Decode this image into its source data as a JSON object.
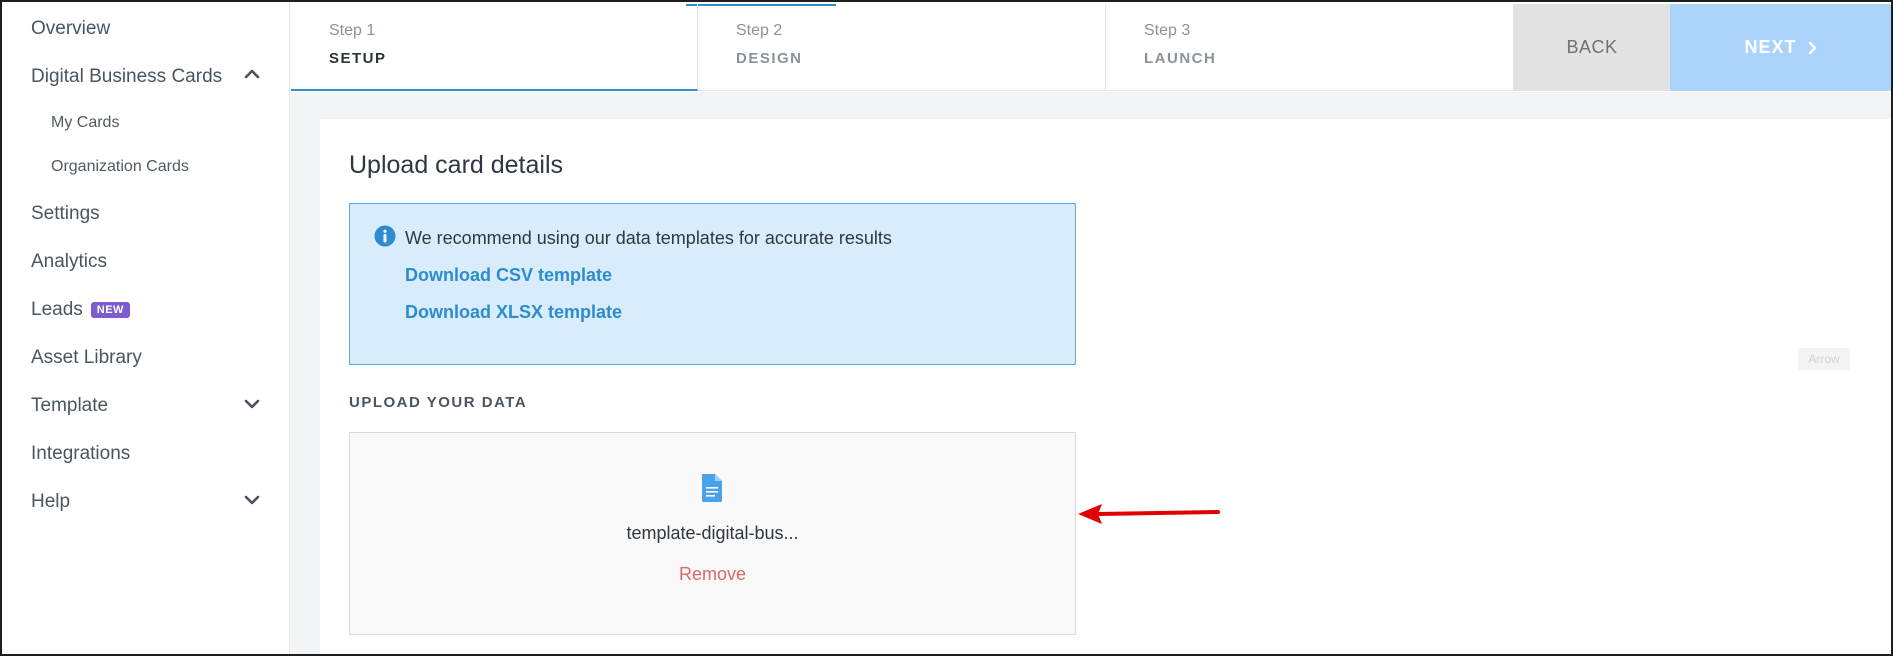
{
  "sidebar": {
    "items": [
      {
        "label": "Overview"
      },
      {
        "label": "Digital Business Cards",
        "icon": "chevron-up-icon"
      },
      {
        "label": "My Cards"
      },
      {
        "label": "Organization Cards"
      },
      {
        "label": "Settings"
      },
      {
        "label": "Analytics"
      },
      {
        "label": "Leads",
        "badge": "NEW"
      },
      {
        "label": "Asset Library"
      },
      {
        "label": "Template",
        "icon": "chevron-down-icon"
      },
      {
        "label": "Integrations"
      },
      {
        "label": "Help",
        "icon": "chevron-down-icon"
      }
    ]
  },
  "stepper": {
    "steps": [
      {
        "num": "Step 1",
        "name": "SETUP",
        "active": true
      },
      {
        "num": "Step 2",
        "name": "DESIGN",
        "active": false
      },
      {
        "num": "Step 3",
        "name": "LAUNCH",
        "active": false
      }
    ],
    "back_label": "BACK",
    "next_label": "NEXT"
  },
  "main": {
    "title": "Upload card details",
    "info": {
      "text": "We recommend using our data templates for accurate results",
      "csv_link": "Download CSV template",
      "xlsx_link": "Download XLSX template"
    },
    "upload_label": "UPLOAD YOUR DATA",
    "file_name": "template-digital-bus...",
    "remove_label": "Remove",
    "ghost_label": "Arrow"
  },
  "colors": {
    "accent": "#2f8fc6",
    "link": "#2d8cd0",
    "next_bg": "#a9d3f8",
    "info_bg": "#d9ecfb",
    "remove": "#e06666",
    "badge": "#7d5ccf",
    "annotation_arrow": "#e00000"
  }
}
